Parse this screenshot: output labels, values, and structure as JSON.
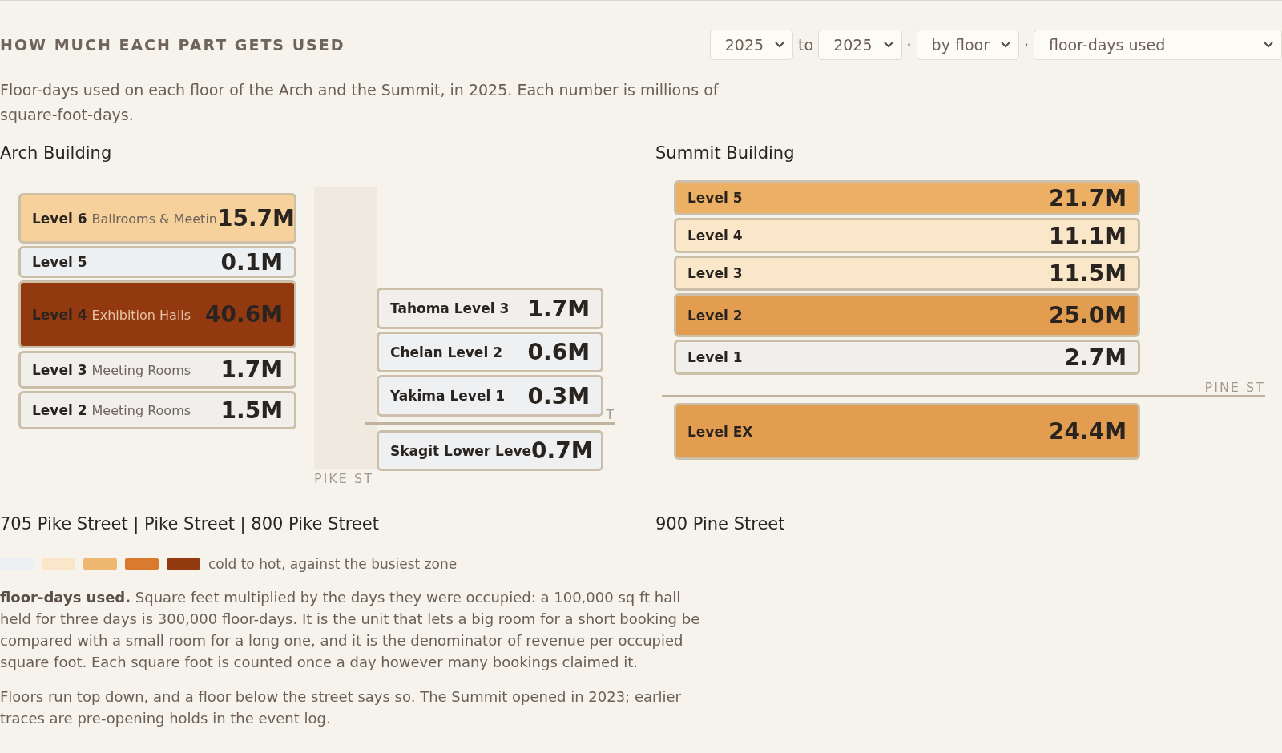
{
  "header": {
    "title": "HOW MUCH EACH PART GETS USED",
    "controls": [
      {
        "kind": "select",
        "value": "2025"
      },
      {
        "kind": "word",
        "value": "to"
      },
      {
        "kind": "select",
        "value": "2025"
      },
      {
        "kind": "word",
        "value": "·"
      },
      {
        "kind": "select",
        "value": "by floor"
      },
      {
        "kind": "word",
        "value": "·"
      },
      {
        "kind": "wide-select",
        "value": "floor-days used"
      }
    ]
  },
  "description": "Floor-days used on each floor of the Arch and the Summit, in 2025. Each number is millions of square-foot-days.",
  "buildings": [
    {
      "name": "Arch Building",
      "address": "705 Pike Street | Pike Street | 800 Pike Street",
      "sections": [
        {
          "kind": "stack",
          "above": [
            {
              "level": "Level 6",
              "use": "Ballrooms & Meetin",
              "value": "15.7M",
              "color": "#f6d19c"
            },
            {
              "level": "Level 5",
              "value": "0.1M",
              "color": "#edf0f3"
            },
            {
              "level": "Level 4",
              "use": "Exhibition Halls",
              "value": "40.6M",
              "color": "#93390f"
            },
            {
              "level": "Level 3",
              "use": "Meeting Rooms",
              "value": "1.7M",
              "color": "#f0efeb"
            },
            {
              "level": "Level 2",
              "use": "Meeting Rooms",
              "value": "1.5M",
              "color": "#f0efeb"
            }
          ]
        },
        {
          "kind": "bridge",
          "label": "PIKE ST"
        },
        {
          "kind": "stack",
          "above": [
            {
              "level": "Tahoma Level 3",
              "value": "1.7M",
              "color": "#f0efeb"
            },
            {
              "level": "Chelan Level 2",
              "value": "0.6M",
              "color": "#eef0f2"
            },
            {
              "level": "Yakima Level 1",
              "value": "0.3M",
              "color": "#eef0f2"
            }
          ],
          "street": "T",
          "below": [
            {
              "level": "Skagit Lower Leve",
              "value": "0.7M",
              "color": "#eef0f2"
            }
          ]
        }
      ]
    },
    {
      "name": "Summit Building",
      "address": "900 Pine Street",
      "sections": [
        {
          "kind": "stack",
          "above": [
            {
              "level": "Level 5",
              "value": "21.7M",
              "color": "#ecb065"
            },
            {
              "level": "Level 4",
              "value": "11.1M",
              "color": "#fae6c8"
            },
            {
              "level": "Level 3",
              "value": "11.5M",
              "color": "#fae6c8"
            },
            {
              "level": "Level 2",
              "value": "25.0M",
              "color": "#e39d50"
            },
            {
              "level": "Level 1",
              "value": "2.7M",
              "color": "#f0efeb"
            }
          ],
          "street": "PINE ST",
          "below": [
            {
              "level": "Level EX",
              "value": "24.4M",
              "color": "#e39d50"
            }
          ]
        }
      ]
    }
  ],
  "legend": {
    "swatches": [
      {
        "color": "#edf0f3"
      },
      {
        "color": "#fae6c8"
      },
      {
        "color": "#efb870"
      },
      {
        "color": "#d97a2e"
      },
      {
        "color": "#93390f"
      }
    ],
    "text": "cold to hot, against the busiest zone"
  },
  "notes": [
    "**floor-days used.** Square feet multiplied by the days they were occupied: a 100,000 sq ft hall held for three days is 300,000 floor-days. It is the unit that lets a big room for a short booking be compared with a small room for a long one, and it is the denominator of revenue per occupied square foot. Each square foot is counted once a day however many bookings claimed it.",
    "Floors run top down, and a floor below the street says so. The Summit opened in 2023; earlier traces are pre-opening holds in the event log."
  ]
}
